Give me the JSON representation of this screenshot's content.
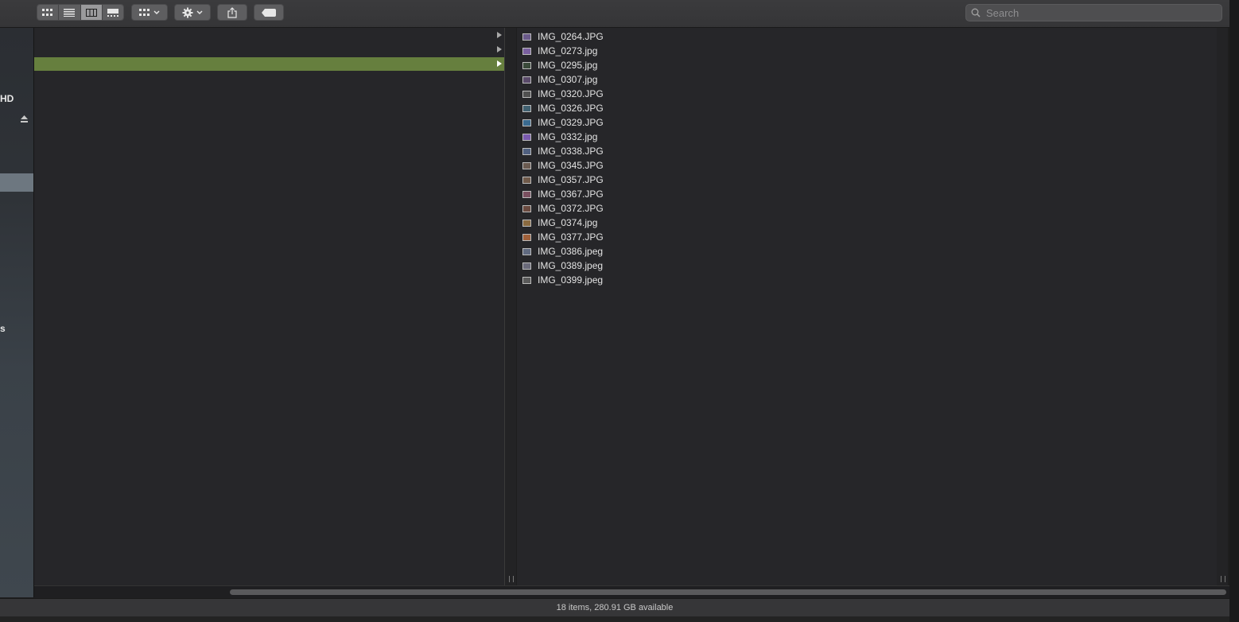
{
  "search": {
    "placeholder": "Search"
  },
  "toolbar": {
    "views": [
      "icon-view",
      "list-view",
      "column-view",
      "gallery-view"
    ],
    "active_view": "column-view"
  },
  "sidebar": {
    "items": [
      {
        "label": ""
      },
      {
        "label": "HD"
      },
      {
        "label": "s"
      }
    ]
  },
  "files": [
    "IMG_0264.JPG",
    "IMG_0273.jpg",
    "IMG_0295.jpg",
    "IMG_0307.jpg",
    "IMG_0320.JPG",
    "IMG_0326.JPG",
    "IMG_0329.JPG",
    "IMG_0332.jpg",
    "IMG_0338.JPG",
    "IMG_0345.JPG",
    "IMG_0357.JPG",
    "IMG_0367.JPG",
    "IMG_0372.JPG",
    "IMG_0374.jpg",
    "IMG_0377.JPG",
    "IMG_0386.jpeg",
    "IMG_0389.jpeg",
    "IMG_0399.jpeg"
  ],
  "status": {
    "text": "18 items, 280.91 GB available"
  },
  "colors": {
    "selection": "#667f3e",
    "background": "#262629"
  }
}
